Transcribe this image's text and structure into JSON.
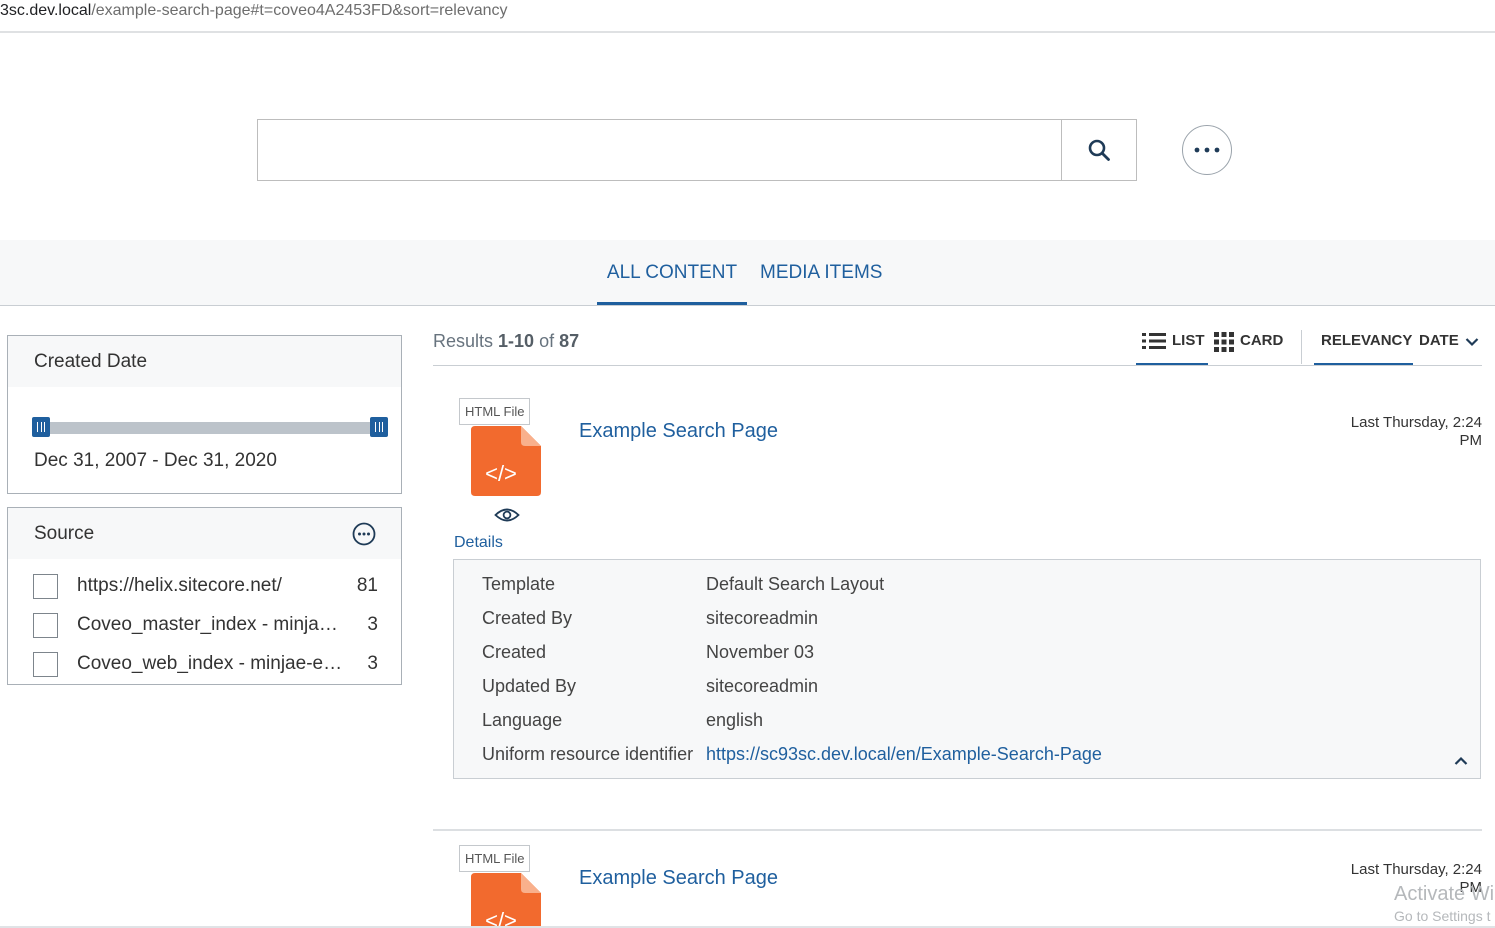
{
  "browser": {
    "url_host": "3sc.dev.local",
    "url_path": "/example-search-page#t=coveo4A2453FD&sort=relevancy"
  },
  "search": {
    "query_value": "",
    "placeholder": ""
  },
  "tabs": [
    {
      "label": "ALL CONTENT",
      "active": true
    },
    {
      "label": "MEDIA ITEMS",
      "active": false
    }
  ],
  "facets": {
    "created_date": {
      "title": "Created Date",
      "range": "Dec 31, 2007 - Dec 31, 2020"
    },
    "source": {
      "title": "Source",
      "items": [
        {
          "label": "https://helix.sitecore.net/",
          "count": "81"
        },
        {
          "label": "Coveo_master_index - minjae-e...",
          "count": "3"
        },
        {
          "label": "Coveo_web_index - minjae-exa...",
          "count": "3"
        }
      ]
    }
  },
  "summary": {
    "prefix": "Results ",
    "first": "1",
    "dash": "-",
    "last": "10",
    "of": " of ",
    "total": "87"
  },
  "layout": {
    "list_label": "LIST",
    "card_label": "CARD",
    "active": "list"
  },
  "sort": {
    "relevancy_label": "RELEVANCY",
    "date_label": "DATE",
    "active": "relevancy"
  },
  "results": [
    {
      "badge": "HTML File",
      "icon_glyph": "</>",
      "title": "Example Search Page",
      "date_line1": "Last Thursday, 2:24",
      "date_line2": "PM",
      "details_label": "Details",
      "fields": [
        {
          "label": "Template",
          "value": "Default Search Layout"
        },
        {
          "label": "Created By",
          "value": "sitecoreadmin"
        },
        {
          "label": "Created",
          "value": "November 03"
        },
        {
          "label": "Updated By",
          "value": "sitecoreadmin"
        },
        {
          "label": "Language",
          "value": "english"
        },
        {
          "label": "Uniform resource identifier",
          "value": "https://sc93sc.dev.local/en/Example-Search-Page"
        }
      ]
    },
    {
      "badge": "HTML File",
      "icon_glyph": "</>",
      "title": "Example Search Page",
      "date_line1": "Last Thursday, 2:24",
      "date_line2": "PM"
    }
  ],
  "watermark": {
    "line1": "Activate Wi",
    "line2": "Go to Settings t"
  },
  "colors": {
    "accent": "#1f5f9e",
    "file_icon": "#f26a2e"
  }
}
